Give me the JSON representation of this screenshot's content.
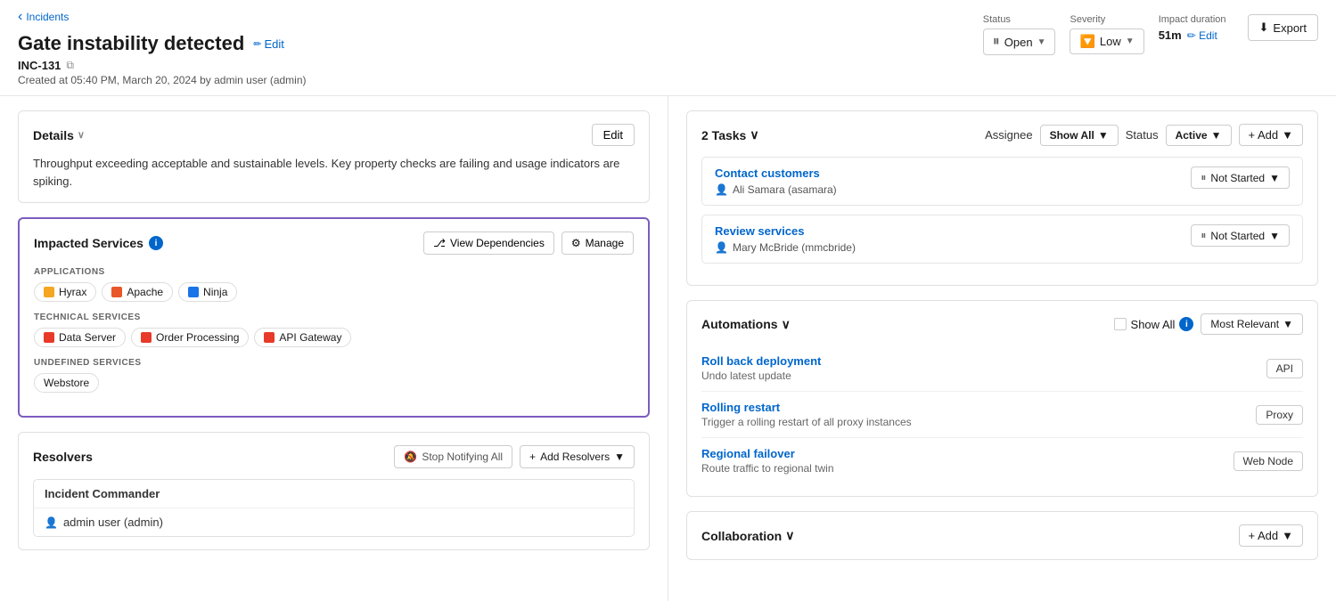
{
  "back": {
    "label": "Incidents"
  },
  "incident": {
    "title": "Gate instability detected",
    "edit_label": "Edit",
    "id": "INC-131",
    "created_at": "Created at 05:40 PM, March 20, 2024 by admin user (admin)"
  },
  "status_bar": {
    "status_label": "Status",
    "status_value": "Open",
    "status_dropdown": "▼",
    "severity_label": "Severity",
    "severity_value": "Low",
    "severity_dropdown": "▼",
    "impact_label": "Impact duration",
    "impact_value": "51m",
    "impact_edit": "Edit",
    "export_label": "Export"
  },
  "details": {
    "section_title": "Details",
    "edit_btn": "Edit",
    "description": "Throughput exceeding acceptable and sustainable levels. Key property checks are failing and usage indicators are spiking."
  },
  "impacted_services": {
    "title": "Impacted Services",
    "view_dependencies_btn": "View Dependencies",
    "manage_btn": "Manage",
    "applications_label": "APPLICATIONS",
    "applications": [
      {
        "name": "Hyrax",
        "icon_type": "yellow"
      },
      {
        "name": "Apache",
        "icon_type": "orange"
      },
      {
        "name": "Ninja",
        "icon_type": "blue"
      }
    ],
    "technical_label": "TECHNICAL SERVICES",
    "technical": [
      {
        "name": "Data Server",
        "icon_type": "red"
      },
      {
        "name": "Order Processing",
        "icon_type": "red"
      },
      {
        "name": "API Gateway",
        "icon_type": "red"
      }
    ],
    "undefined_label": "UNDEFINED SERVICES",
    "undefined": [
      {
        "name": "Webstore",
        "icon_type": "plain"
      }
    ]
  },
  "resolvers": {
    "title": "Resolvers",
    "stop_btn": "Stop Notifying All",
    "add_btn": "Add Resolvers",
    "groups": [
      {
        "name": "Incident Commander",
        "members": [
          "admin user (admin)"
        ]
      }
    ]
  },
  "tasks": {
    "title": "2 Tasks",
    "assignee_label": "Assignee",
    "assignee_value": "Show All",
    "status_label": "Status",
    "status_value": "Active",
    "add_label": "+ Add",
    "items": [
      {
        "title": "Contact customers",
        "assignee": "Ali Samara (asamara)",
        "status": "Not Started"
      },
      {
        "title": "Review services",
        "assignee": "Mary McBride (mmcbride)",
        "status": "Not Started"
      }
    ]
  },
  "automations": {
    "title": "Automations",
    "show_all_label": "Show All",
    "relevant_label": "Most Relevant",
    "items": [
      {
        "title": "Roll back deployment",
        "desc": "Undo latest update",
        "tag": "API"
      },
      {
        "title": "Rolling restart",
        "desc": "Trigger a rolling restart of all proxy instances",
        "tag": "Proxy"
      },
      {
        "title": "Regional failover",
        "desc": "Route traffic to regional twin",
        "tag": "Web Node"
      }
    ]
  },
  "collaboration": {
    "title": "Collaboration",
    "add_label": "+ Add"
  }
}
